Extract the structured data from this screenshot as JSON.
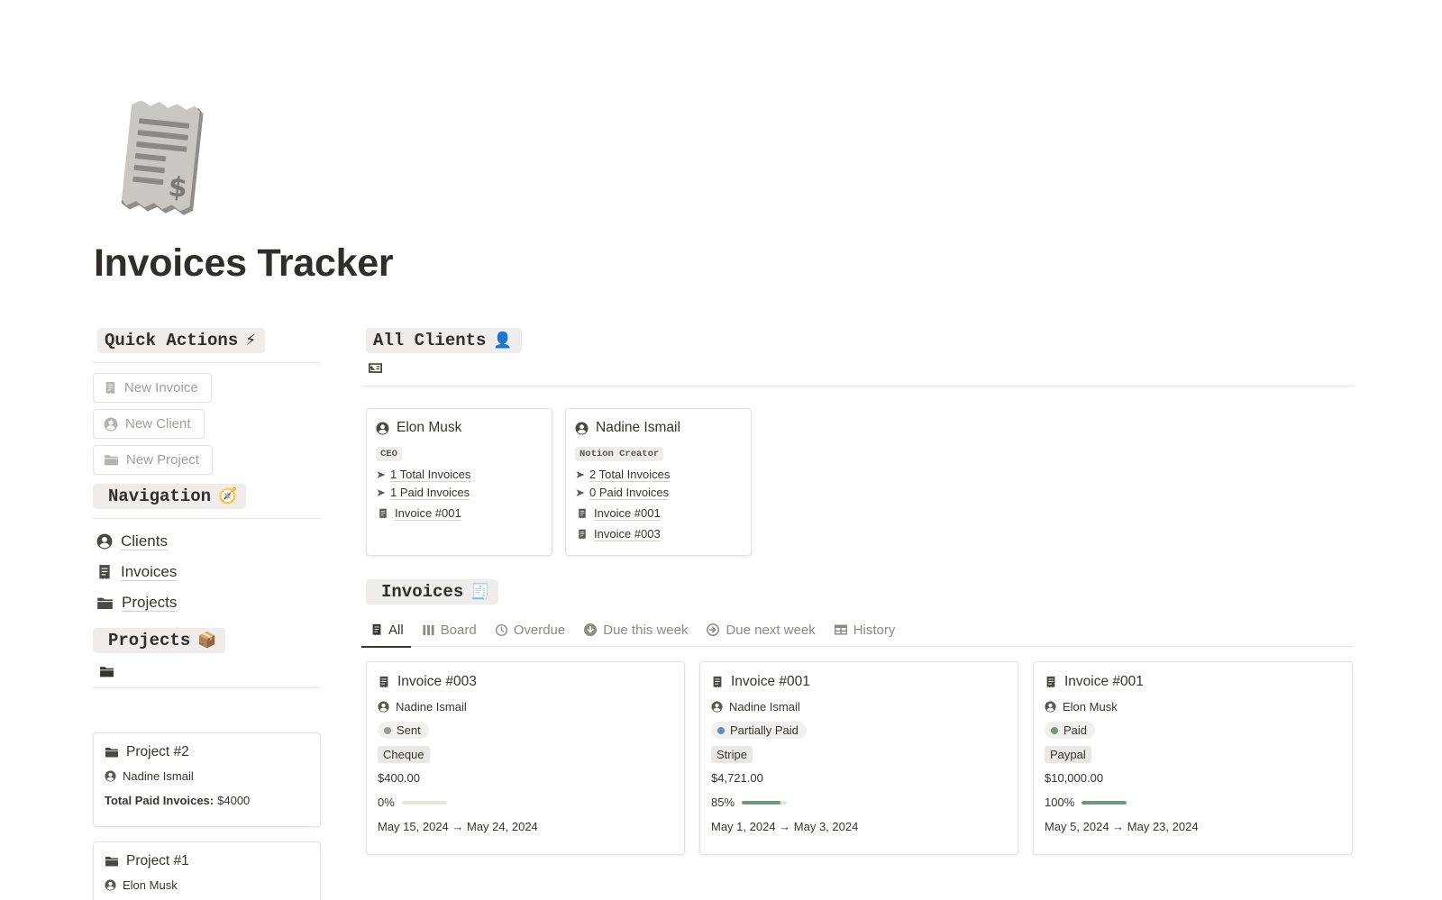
{
  "page": {
    "title": "Invoices Tracker",
    "icon": "receipt-icon"
  },
  "quick_actions": {
    "heading": "Quick Actions",
    "heading_emoji": "⚡",
    "buttons": [
      {
        "label": "New Invoice",
        "icon": "receipt-icon"
      },
      {
        "label": "New Client",
        "icon": "user-circle-icon"
      },
      {
        "label": "New Project",
        "icon": "folder-icon"
      }
    ]
  },
  "navigation": {
    "heading": "Navigation",
    "heading_emoji": "🧭",
    "items": [
      {
        "label": "Clients",
        "icon": "user-circle-icon"
      },
      {
        "label": "Invoices",
        "icon": "receipt-icon"
      },
      {
        "label": "Projects",
        "icon": "folder-icon"
      }
    ]
  },
  "projects": {
    "heading": "Projects",
    "heading_emoji": "📦",
    "view_icon": "folder-icon",
    "cards": [
      {
        "title": "Project #2",
        "client": "Nadine Ismail",
        "paid_label": "Total Paid Invoices:",
        "paid_value": "$4000"
      },
      {
        "title": "Project #1",
        "client": "Elon Musk"
      }
    ]
  },
  "clients": {
    "heading": "All Clients",
    "heading_emoji": "👤",
    "view_icon": "contact-card-icon",
    "cards": [
      {
        "name": "Elon Musk",
        "role": "CEO",
        "total": "1 Total Invoices",
        "paid": "1 Paid Invoices",
        "invoices": [
          "Invoice #001"
        ]
      },
      {
        "name": "Nadine Ismail",
        "role": "Notion Creator",
        "total": "2 Total Invoices",
        "paid": "0 Paid Invoices",
        "invoices": [
          "Invoice #001",
          "Invoice #003"
        ]
      }
    ]
  },
  "invoices": {
    "heading": "Invoices",
    "heading_emoji": "🧾",
    "tabs": [
      {
        "label": "All",
        "icon": "receipt-icon",
        "active": true
      },
      {
        "label": "Board",
        "icon": "board-columns-icon"
      },
      {
        "label": "Overdue",
        "icon": "clock-icon"
      },
      {
        "label": "Due this week",
        "icon": "arrow-down-circle-icon"
      },
      {
        "label": "Due next week",
        "icon": "arrow-right-circle-icon"
      },
      {
        "label": "History",
        "icon": "table-icon"
      }
    ],
    "cards": [
      {
        "title": "Invoice #003",
        "client": "Nadine Ismail",
        "status": "Sent",
        "status_color": "#9b9a97",
        "method": "Cheque",
        "amount": "$400.00",
        "progress_label": "0%",
        "progress": 0,
        "dates": "May 15, 2024 → May 24, 2024"
      },
      {
        "title": "Invoice #001",
        "client": "Nadine Ismail",
        "status": "Partially Paid",
        "status_color": "#5e8ec8",
        "method": "Stripe",
        "amount": "$4,721.00",
        "progress_label": "85%",
        "progress": 0.85,
        "dates": "May 1, 2024 → May 3, 2024"
      },
      {
        "title": "Invoice #001",
        "client": "Elon Musk",
        "status": "Paid",
        "status_color": "#6b9a7a",
        "method": "Paypal",
        "amount": "$10,000.00",
        "progress_label": "100%",
        "progress": 1,
        "dates": "May 5, 2024 → May 23, 2024"
      }
    ]
  }
}
